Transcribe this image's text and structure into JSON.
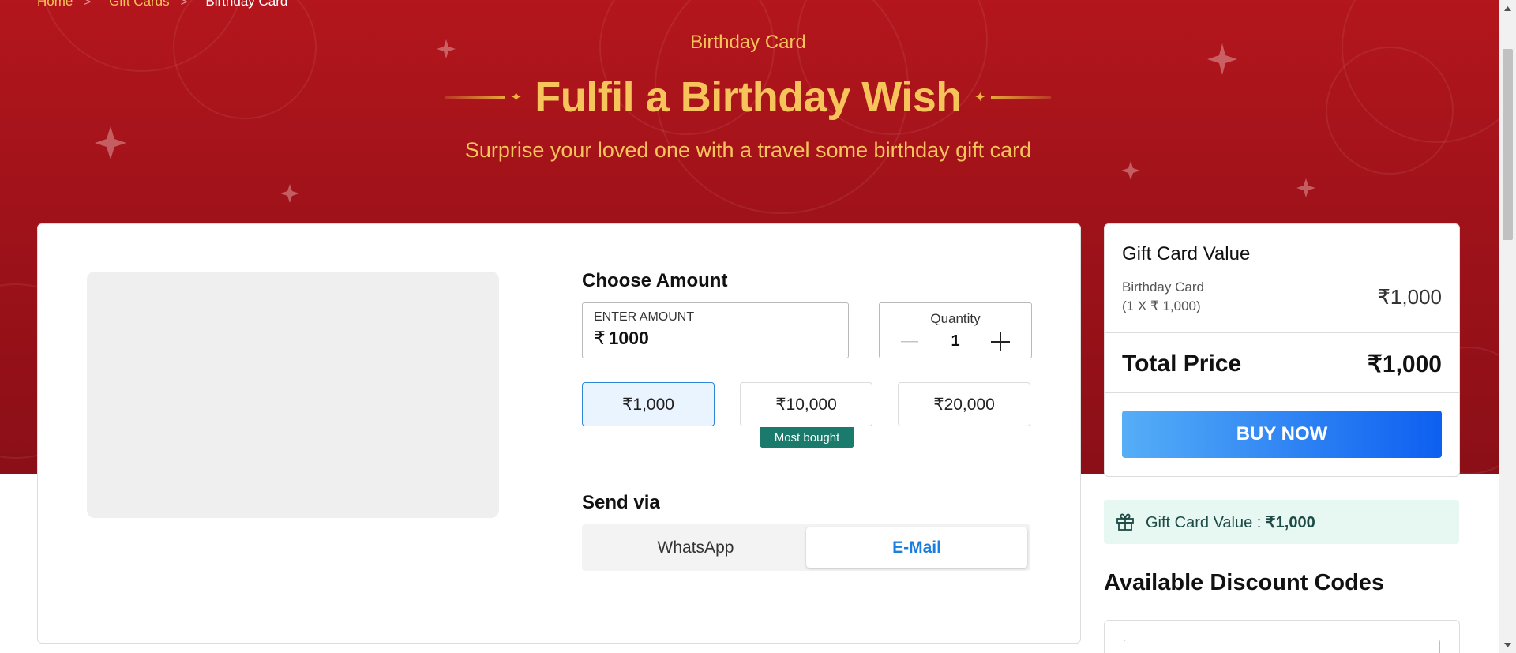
{
  "breadcrumb": {
    "home": "Home",
    "gift_cards": "Gift Cards",
    "current": "Birthday Card",
    "separator": ">"
  },
  "hero": {
    "eyebrow": "Birthday Card",
    "headline": "Fulfil a Birthday Wish",
    "subtitle": "Surprise your loved one with a travel some birthday gift card"
  },
  "choose_amount": {
    "title": "Choose Amount",
    "input_label": "ENTER AMOUNT",
    "currency_symbol": "₹",
    "input_value": "1000",
    "quantity_label": "Quantity",
    "quantity_value": "1",
    "options": [
      "₹1,000",
      "₹10,000",
      "₹20,000"
    ],
    "selected_option": "₹1,000",
    "most_bought_badge": "Most bought"
  },
  "send_via": {
    "title": "Send via",
    "options": [
      "WhatsApp",
      "E-Mail"
    ],
    "selected": "E-Mail"
  },
  "summary": {
    "title": "Gift Card Value",
    "item_label": "Birthday Card",
    "item_detail": "(1 X ₹ 1,000)",
    "item_price": "₹1,000",
    "total_label": "Total Price",
    "total_value": "₹1,000",
    "buy_button": "BUY NOW"
  },
  "gift_value_strip": {
    "label": "Gift Card Value : ",
    "value": "₹1,000"
  },
  "discount": {
    "title": "Available Discount Codes"
  },
  "colors": {
    "hero_red": "#a0121a",
    "gold": "#f7c45c",
    "selected_blue": "#2f86d8",
    "badge_teal": "#1a7a6c",
    "buy_gradient_start": "#56aef7",
    "buy_gradient_end": "#0d5ff0",
    "email_blue": "#1a7de0",
    "strip_green": "#e6f8f1"
  },
  "icons": {
    "breadcrumb_separator": "chevron-right-icon",
    "minus": "minus-icon",
    "plus": "plus-icon",
    "gift": "gift-icon",
    "scroll_up": "caret-up-icon",
    "scroll_down": "caret-down-icon"
  }
}
